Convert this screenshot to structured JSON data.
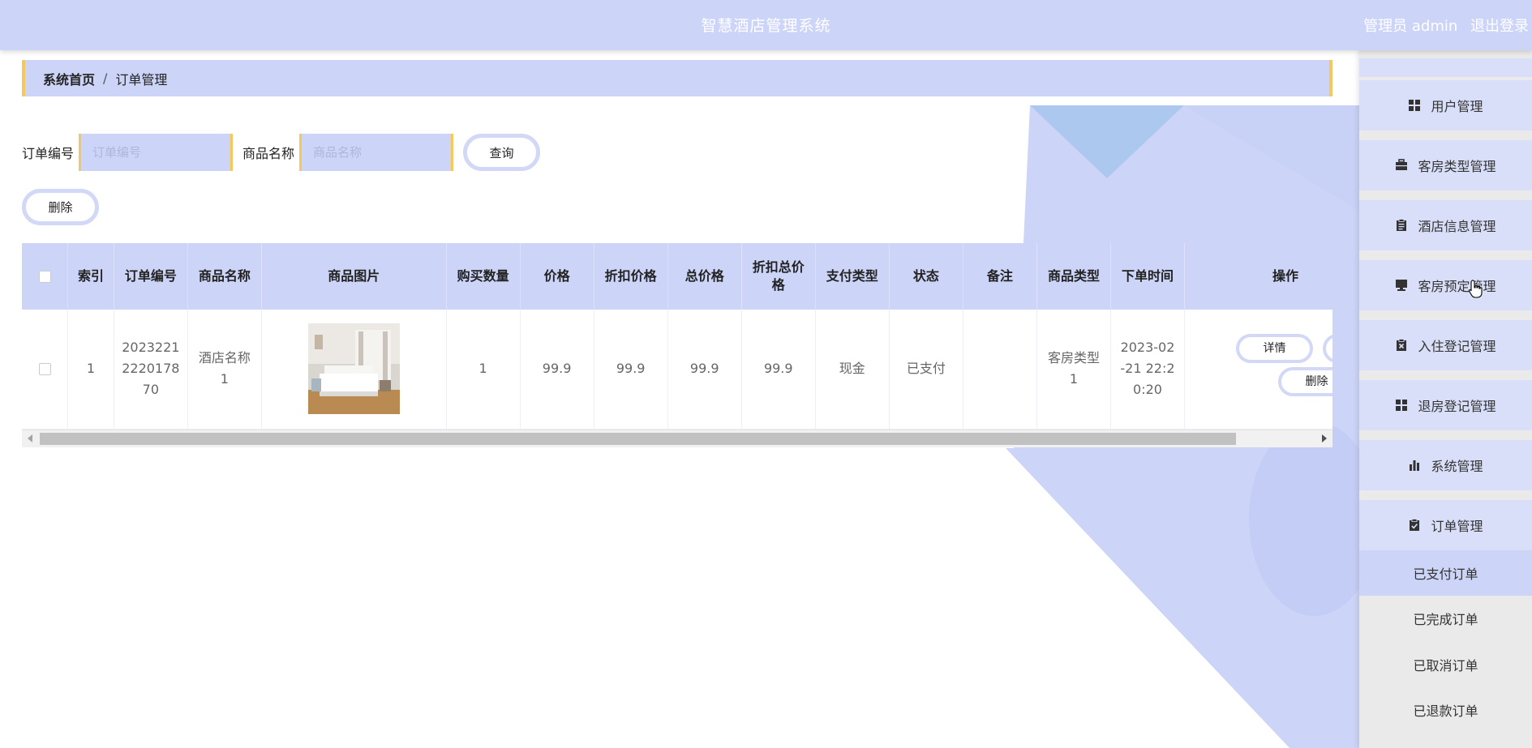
{
  "header": {
    "title": "智慧酒店管理系统",
    "user_label": "管理员 admin",
    "logout": "退出登录"
  },
  "breadcrumb": {
    "home": "系统首页",
    "separator": "/",
    "current": "订单管理"
  },
  "search": {
    "order_no_label": "订单编号",
    "order_no_placeholder": "订单编号",
    "goods_name_label": "商品名称",
    "goods_name_placeholder": "商品名称",
    "query_button": "查询"
  },
  "actions": {
    "delete_button": "删除"
  },
  "table": {
    "headers": [
      "索引",
      "订单编号",
      "商品名称",
      "商品图片",
      "购买数量",
      "价格",
      "折扣价格",
      "总价格",
      "折扣总价格",
      "支付类型",
      "状态",
      "备注",
      "商品类型",
      "下单时间",
      "操作"
    ],
    "rows": [
      {
        "index": "1",
        "order_no": "202322122201787 0",
        "order_no_lines": [
          "2023221",
          "2220178",
          "70"
        ],
        "goods_name_lines": [
          "酒店名称",
          "1"
        ],
        "quantity": "1",
        "price": "99.9",
        "discount_price": "99.9",
        "total_price": "99.9",
        "discount_total": "99.9",
        "pay_type": "现金",
        "status": "已支付",
        "remark": "",
        "goods_type_lines": [
          "客房类型",
          "1"
        ],
        "order_time_lines": [
          "2023-02",
          "-21 22:2",
          "0:20"
        ],
        "detail_button": "详情",
        "delete_button": "删除"
      }
    ]
  },
  "sidebar": {
    "items": [
      {
        "label": "用户管理",
        "icon": "grid-icon"
      },
      {
        "label": "客房类型管理",
        "icon": "briefcase-icon"
      },
      {
        "label": "酒店信息管理",
        "icon": "clipboard-icon"
      },
      {
        "label": "客房预定管理",
        "icon": "monitor-icon"
      },
      {
        "label": "入住登记管理",
        "icon": "clipboard-x-icon"
      },
      {
        "label": "退房登记管理",
        "icon": "grid-icon"
      },
      {
        "label": "系统管理",
        "icon": "bar-chart-icon"
      },
      {
        "label": "订单管理",
        "icon": "clipboard-check-icon"
      }
    ],
    "sub_items": [
      {
        "label": "已支付订单",
        "active": true
      },
      {
        "label": "已完成订单",
        "active": false
      },
      {
        "label": "已取消订单",
        "active": false
      },
      {
        "label": "已退款订单",
        "active": false
      }
    ]
  },
  "colors": {
    "accent": "#ccd4f7",
    "border_accent": "#f6c75a",
    "deco_light": "#d0d8f8",
    "deco_blue": "#adc8ee"
  }
}
